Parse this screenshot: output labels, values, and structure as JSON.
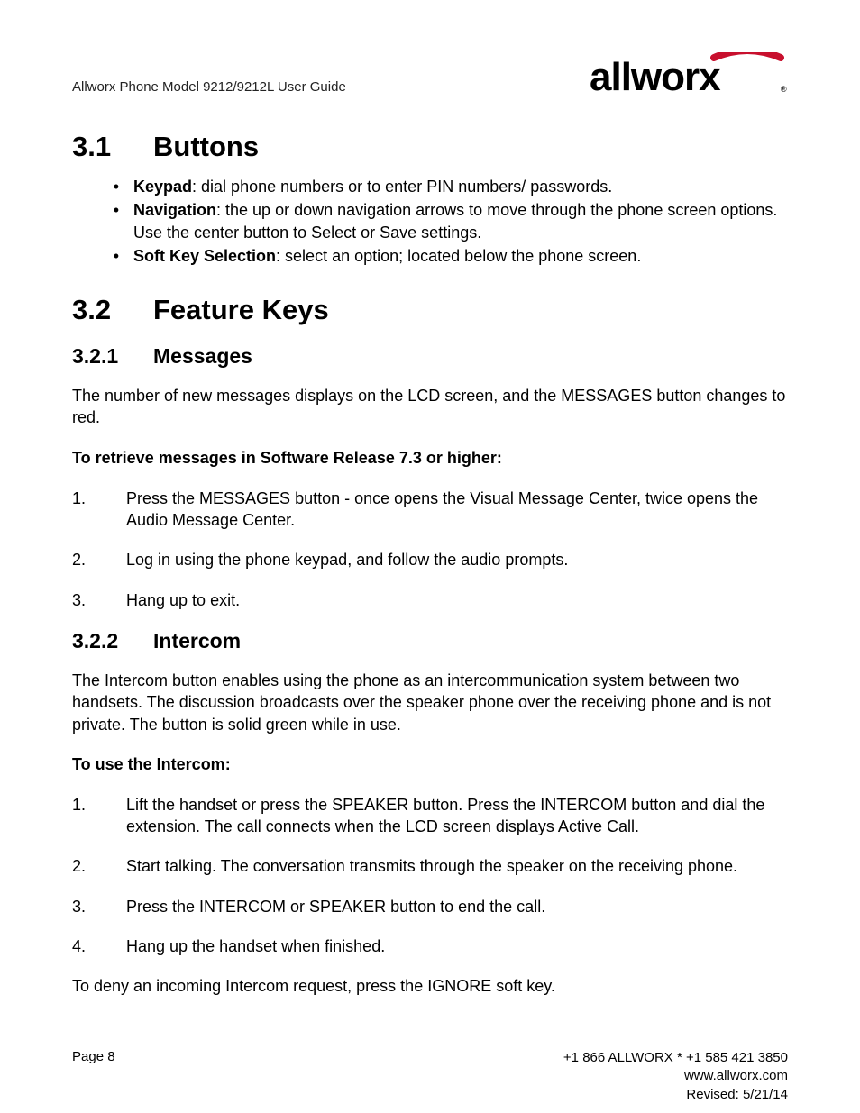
{
  "header": {
    "doc_title": "Allworx Phone Model 9212/9212L User Guide",
    "logo_text": "allworx"
  },
  "s31": {
    "num": "3.1",
    "title": "Buttons",
    "bullets": [
      {
        "bold": "Keypad",
        "rest": ": dial phone numbers or to enter PIN numbers/ passwords."
      },
      {
        "bold": "Navigation",
        "rest": ": the up or down navigation arrows to move through the phone screen options. Use the center button to Select or Save settings."
      },
      {
        "bold": "Soft Key Selection",
        "rest": ": select an option; located below the phone screen."
      }
    ]
  },
  "s32": {
    "num": "3.2",
    "title": "Feature Keys"
  },
  "s321": {
    "num": "3.2.1",
    "title": "Messages",
    "para": "The number of new messages displays on the LCD screen, and the MESSAGES button changes to red.",
    "instr": "To retrieve messages in Software Release 7.3 or higher:",
    "steps": [
      "Press the MESSAGES button - once opens the Visual Message Center, twice opens the Audio Message Center.",
      "Log in using the phone keypad, and follow the audio prompts.",
      "Hang up to exit."
    ]
  },
  "s322": {
    "num": "3.2.2",
    "title": "Intercom",
    "para": "The Intercom button enables using the phone as an intercommunication system between two handsets. The discussion broadcasts over the speaker phone over the receiving phone and is not private. The button is solid green while in use.",
    "instr": "To use the Intercom:",
    "steps": [
      "Lift the handset or press the SPEAKER button. Press the INTERCOM button and dial the extension. The call connects when the LCD screen displays Active Call.",
      "Start talking. The conversation transmits through the speaker on the receiving phone.",
      "Press the INTERCOM or SPEAKER button to end the call.",
      "Hang up the handset when finished."
    ],
    "after": "To deny an incoming Intercom request, press the IGNORE soft key."
  },
  "footer": {
    "page": "Page 8",
    "phone": "+1 866 ALLWORX * +1 585 421 3850",
    "url": "www.allworx.com",
    "revised": "Revised: 5/21/14"
  }
}
